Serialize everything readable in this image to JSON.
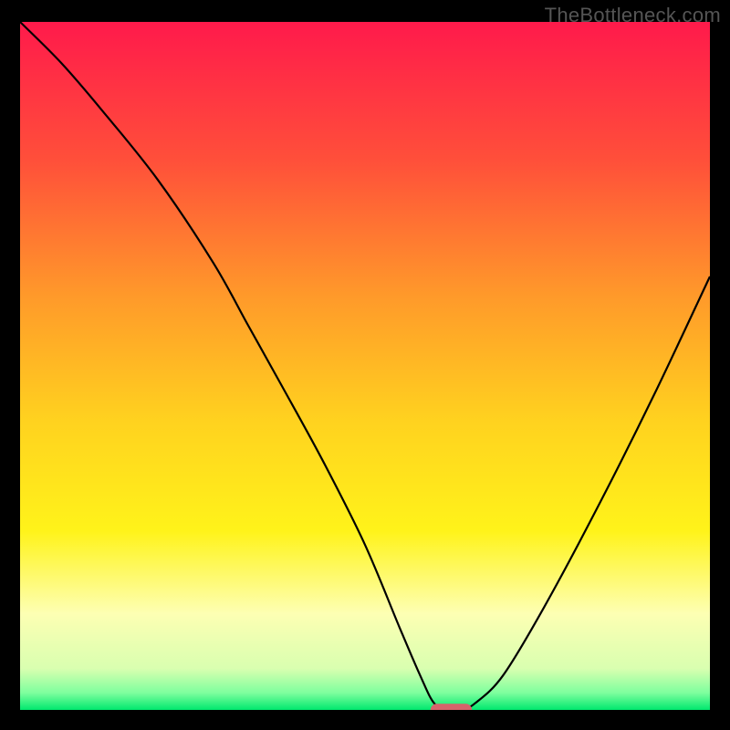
{
  "watermark": "TheBottleneck.com",
  "chart_data": {
    "type": "line",
    "title": "",
    "xlabel": "",
    "ylabel": "",
    "xlim": [
      0,
      100
    ],
    "ylim": [
      0,
      100
    ],
    "grid": false,
    "legend": false,
    "background_gradient": {
      "stops": [
        {
          "offset": 0.0,
          "color": "#ff1a4b"
        },
        {
          "offset": 0.2,
          "color": "#ff4f3a"
        },
        {
          "offset": 0.4,
          "color": "#ff9a2a"
        },
        {
          "offset": 0.58,
          "color": "#ffd21f"
        },
        {
          "offset": 0.74,
          "color": "#fff31a"
        },
        {
          "offset": 0.86,
          "color": "#fdffb3"
        },
        {
          "offset": 0.94,
          "color": "#d9ffb0"
        },
        {
          "offset": 0.975,
          "color": "#7eff9e"
        },
        {
          "offset": 1.0,
          "color": "#00e86e"
        }
      ]
    },
    "series": [
      {
        "name": "bottleneck-curve",
        "color": "#000000",
        "x": [
          0,
          6,
          12,
          20,
          28,
          33,
          38,
          44,
          50,
          55,
          58,
          60,
          62,
          64,
          66,
          70,
          76,
          84,
          92,
          100
        ],
        "y": [
          100,
          94,
          87,
          77,
          65,
          56,
          47,
          36,
          24,
          12,
          5,
          1,
          0,
          0,
          1,
          5,
          15,
          30,
          46,
          63
        ]
      }
    ],
    "marker": {
      "name": "optimal-point",
      "x": 62.5,
      "y": 0,
      "color": "#d6636b",
      "width": 6,
      "height": 1.8
    }
  }
}
